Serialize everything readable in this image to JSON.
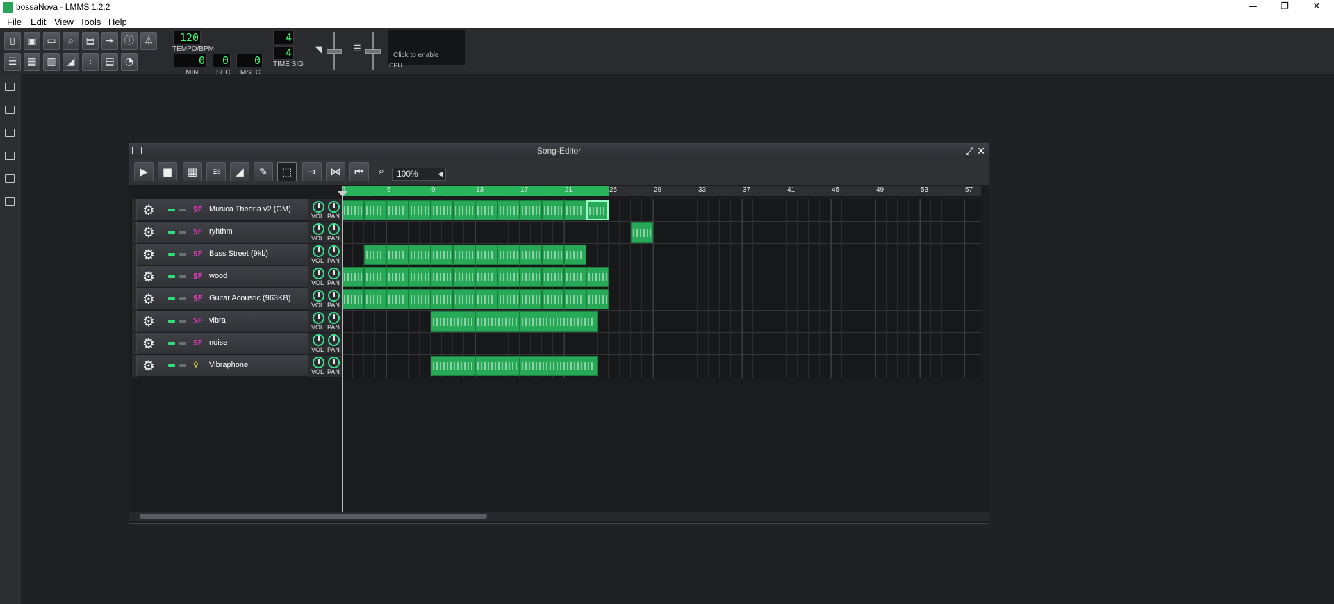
{
  "window": {
    "title": "bossaNova - LMMS 1.2.2",
    "minimize": "—",
    "restore": "❐",
    "close": "✕"
  },
  "menu": [
    "File",
    "Edit",
    "View",
    "Tools",
    "Help"
  ],
  "transport": {
    "tempo": "120",
    "tempo_label": "TEMPO/BPM",
    "min": "0",
    "min_label": "MIN",
    "sec": "0",
    "sec_label": "SEC",
    "msec": "0",
    "msec_label": "MSEC",
    "ts_num": "4",
    "ts_den": "4",
    "ts_label": "TIME SIG",
    "cpu_hint": "Click to enable",
    "cpu_label": "CPU"
  },
  "song_editor": {
    "title": "Song-Editor",
    "zoom": "100%",
    "bar_labels": [
      "1",
      "5",
      "9",
      "13",
      "17",
      "21",
      "25",
      "29",
      "33",
      "37",
      "41",
      "45",
      "49",
      "53",
      "57"
    ],
    "loop_end_bar": 25,
    "tracks": [
      {
        "name": "Musica Theoria v2 (GM)",
        "type": "sf2",
        "icon_text": "SF",
        "vol_label": "VOL",
        "pan_label": "PAN"
      },
      {
        "name": "ryhthm",
        "type": "sf2",
        "icon_text": "SF",
        "vol_label": "VOL",
        "pan_label": "PAN"
      },
      {
        "name": "Bass Street (9kb)",
        "type": "sf2",
        "icon_text": "SF",
        "vol_label": "VOL",
        "pan_label": "PAN"
      },
      {
        "name": "wood",
        "type": "sf2",
        "icon_text": "SF",
        "vol_label": "VOL",
        "pan_label": "PAN"
      },
      {
        "name": "Guitar Acoustic (963KB)",
        "type": "sf2",
        "icon_text": "SF",
        "vol_label": "VOL",
        "pan_label": "PAN"
      },
      {
        "name": "vibra",
        "type": "sf2",
        "icon_text": "SF",
        "vol_label": "VOL",
        "pan_label": "PAN"
      },
      {
        "name": "noise",
        "type": "sf2",
        "icon_text": "SF",
        "vol_label": "VOL",
        "pan_label": "PAN"
      },
      {
        "name": "Vibraphone",
        "type": "vibed",
        "icon_text": "♀",
        "vol_label": "VOL",
        "pan_label": "PAN"
      }
    ]
  },
  "colors": {
    "accent": "#27a957",
    "lcd": "#3bff76",
    "background": "#1f2124"
  }
}
